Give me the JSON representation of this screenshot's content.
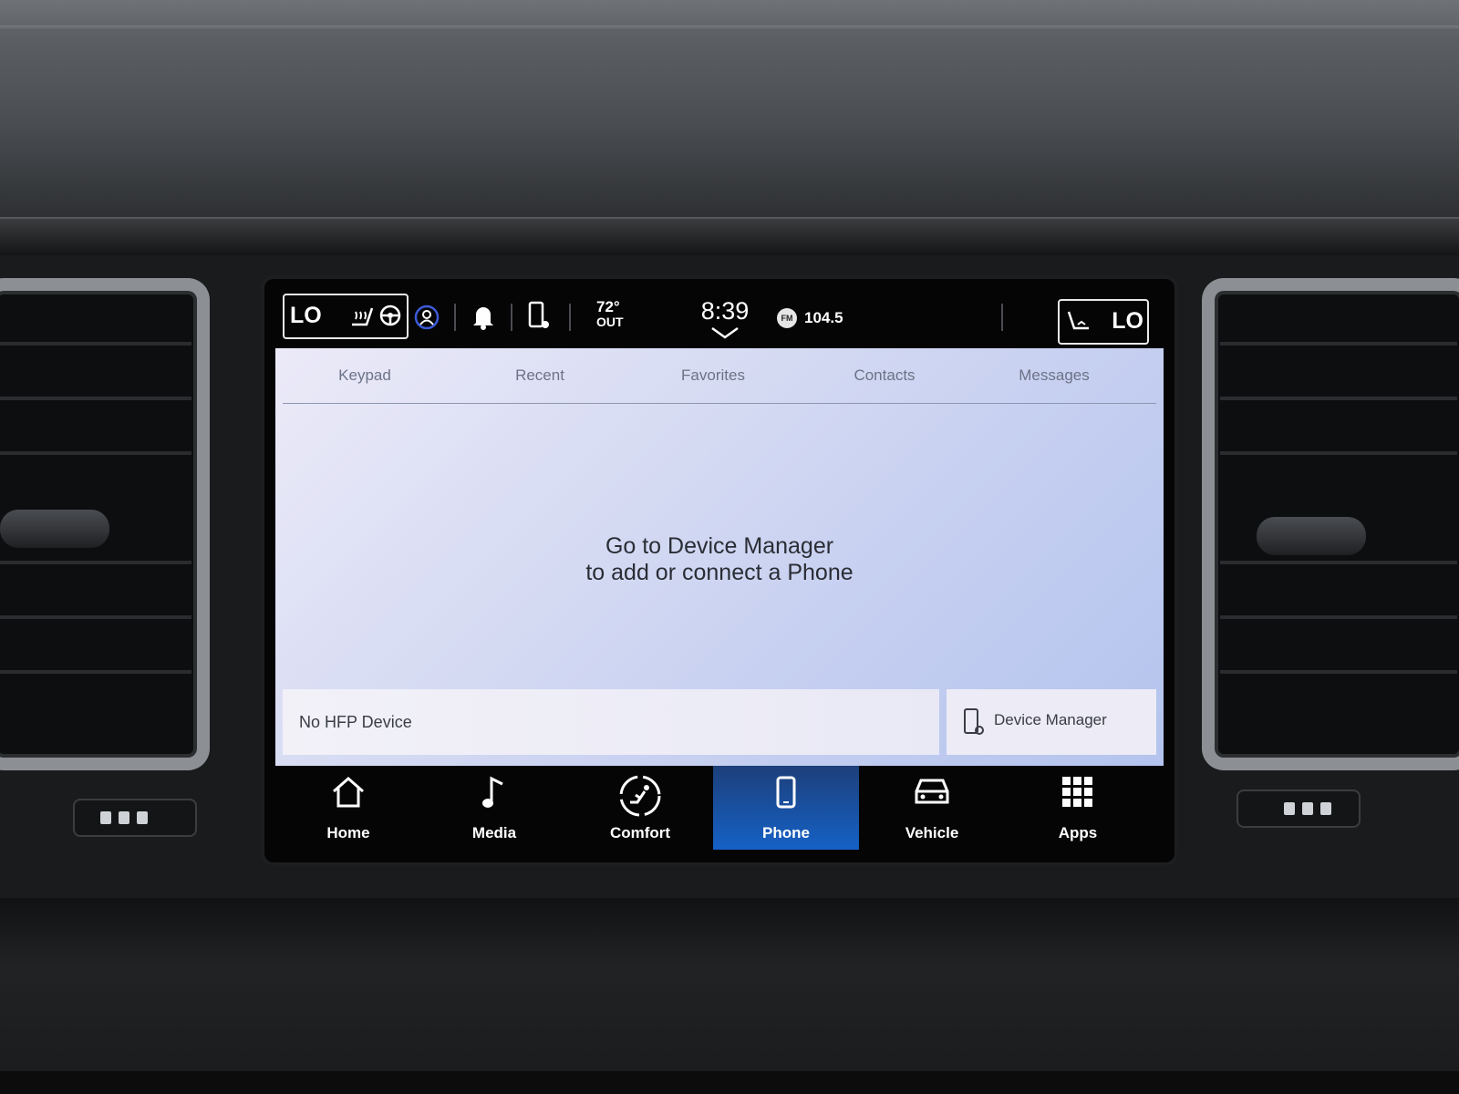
{
  "status_bar": {
    "left_seat_level": "LO",
    "right_seat_level": "LO",
    "outside_temp": "72°",
    "outside_label": "OUT",
    "clock": "8:39",
    "radio_band": "FM",
    "radio_frequency": "104.5"
  },
  "tabs": [
    {
      "label": "Keypad"
    },
    {
      "label": "Recent"
    },
    {
      "label": "Favorites"
    },
    {
      "label": "Contacts"
    },
    {
      "label": "Messages"
    }
  ],
  "main": {
    "message_line1": "Go to Device Manager",
    "message_line2": "to add or connect a Phone"
  },
  "footer": {
    "hfp_status": "No HFP Device",
    "device_manager_label": "Device Manager"
  },
  "nav": [
    {
      "label": "Home",
      "icon": "home-icon"
    },
    {
      "label": "Media",
      "icon": "music-note-icon"
    },
    {
      "label": "Comfort",
      "icon": "comfort-seat-icon"
    },
    {
      "label": "Phone",
      "icon": "phone-icon",
      "active": true
    },
    {
      "label": "Vehicle",
      "icon": "car-icon"
    },
    {
      "label": "Apps",
      "icon": "apps-grid-icon"
    }
  ],
  "colors": {
    "active_nav": "#1561c6",
    "screen_background": "#c3cdf0",
    "status_text": "#ffffff"
  }
}
